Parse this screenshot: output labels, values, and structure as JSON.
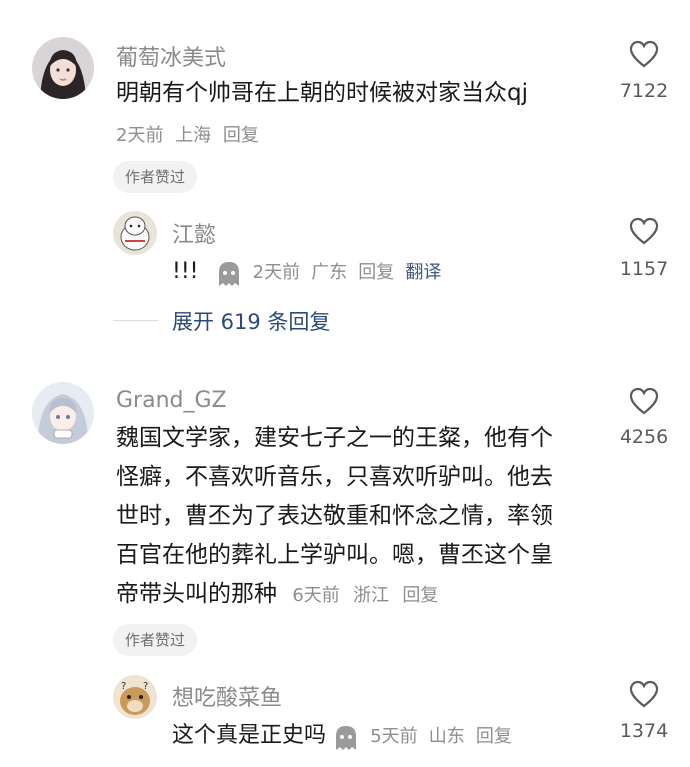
{
  "comments": [
    {
      "username": "葡萄冰美式",
      "text": "明朝有个帅哥在上朝的时候被对家当众qj",
      "time": "2天前",
      "location": "上海",
      "reply": "回复",
      "badge": "作者赞过",
      "likes": "7122"
    },
    {
      "username": "江懿",
      "text": "!!!",
      "time": "2天前",
      "location": "广东",
      "reply": "回复",
      "translate": "翻译",
      "likes": "1157"
    },
    {
      "expand": "展开 619 条回复"
    },
    {
      "username": "Grand_GZ",
      "text_lines": [
        "魏国文学家，建安七子之一的王粲，他有个",
        "怪癖，不喜欢听音乐，只喜欢听驴叫。他去",
        "世时，曹丕为了表达敬重和怀念之情，率领",
        "百官在他的葬礼上学驴叫。嗯，曹丕这个皇",
        "帝带头叫的那种"
      ],
      "time": "6天前",
      "location": "浙江",
      "reply": "回复",
      "badge": "作者赞过",
      "likes": "4256"
    },
    {
      "username": "想吃酸菜鱼",
      "text": "这个真是正史吗",
      "time": "5天前",
      "location": "山东",
      "reply": "回复",
      "likes": "1374"
    }
  ],
  "colors": {
    "background": "#ffffff",
    "name": "#8a8a8a",
    "text": "#1a1a1a",
    "meta": "#8e8e8e",
    "link": "#2a4a78",
    "badge_bg": "#f2f2f2"
  }
}
